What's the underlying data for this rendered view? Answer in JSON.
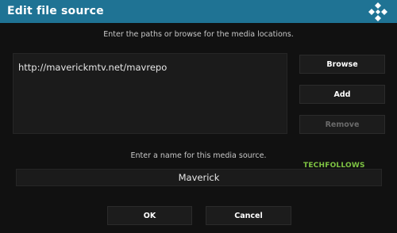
{
  "dialog": {
    "title": "Edit file source",
    "logo_icon": "kodi-logo-icon"
  },
  "paths": {
    "instruction": "Enter the paths or browse for the media locations.",
    "items": [
      "http://maverickmtv.net/mavrepo"
    ]
  },
  "buttons": {
    "browse": "Browse",
    "add": "Add",
    "remove": "Remove",
    "ok": "OK",
    "cancel": "Cancel"
  },
  "name": {
    "instruction": "Enter a name for this media source.",
    "value": "Maverick"
  },
  "watermark": "TECHFOLLOWS",
  "colors": {
    "titlebar": "#1f7394",
    "background": "#111111",
    "button": "#1c1c1c",
    "watermark": "#7ec443"
  }
}
